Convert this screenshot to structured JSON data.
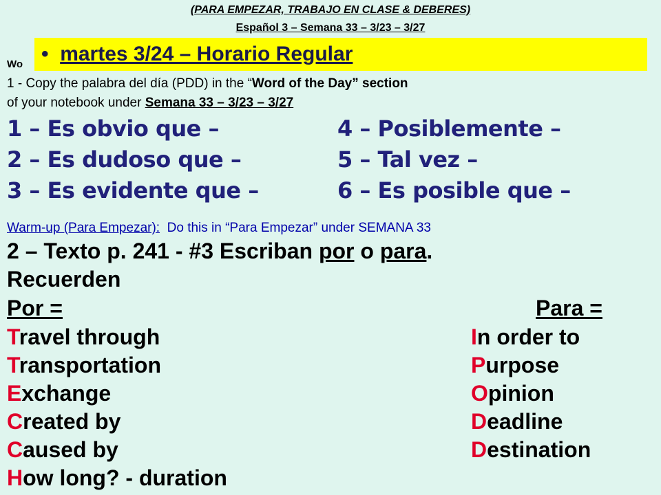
{
  "header": {
    "line1": "(PARA EMPEZAR, TRABAJO EN CLASE & DEBERES)",
    "line2": "Español 3 – Semana 33 – 3/23 – 3/27"
  },
  "banner": {
    "bullet": "•",
    "text": "martes 3/24 – Horario Regular"
  },
  "word_of_day": {
    "heading_visible": "Wo",
    "instruction_prefix": "1 - Copy the palabra del día (PDD) in the “",
    "instruction_bold": "Word of the Day”",
    "instruction_suffix": " section",
    "instruction_line2_prefix": "of your notebook under ",
    "instruction_line2_underlined": "Semana 33 – 3/23 – 3/27",
    "items_left": [
      "1 – Es obvio que –",
      "2 – Es dudoso que –",
      "3 – Es evidente que –"
    ],
    "items_right": [
      "4 – Posiblemente –",
      "5 – Tal vez –",
      "6 – Es posible que –"
    ]
  },
  "warmup": {
    "label": "Warm-up (Para Empezar):",
    "instruction": "Do this in “Para Empezar” under SEMANA 33",
    "task_prefix": "2 –  Texto p. 241 - #3 Escriban ",
    "task_por": "por",
    "task_o": " o ",
    "task_para": "para",
    "task_end": ".",
    "recuerden": "Recuerden"
  },
  "por": {
    "heading": "Por =",
    "items": [
      {
        "first": "T",
        "rest": "ravel through"
      },
      {
        "first": "T",
        "rest": "ransportation"
      },
      {
        "first": "E",
        "rest": "xchange"
      },
      {
        "first": "C",
        "rest": "reated by"
      },
      {
        "first": "C",
        "rest": "aused by"
      },
      {
        "first": "H",
        "rest": "ow long? - duration"
      }
    ]
  },
  "para": {
    "heading": "Para =",
    "items": [
      {
        "first": "I",
        "rest": "n order to"
      },
      {
        "first": "P",
        "rest": "urpose"
      },
      {
        "first": "O",
        "rest": "pinion"
      },
      {
        "first": "D",
        "rest": "eadline"
      },
      {
        "first": "D",
        "rest": "estination"
      }
    ]
  },
  "colors": {
    "background": "#dff5ee",
    "banner": "#ffff00",
    "pdd_text": "#21217a",
    "warmup_text": "#0000aa",
    "mnemonic_initial": "#e0002a"
  }
}
